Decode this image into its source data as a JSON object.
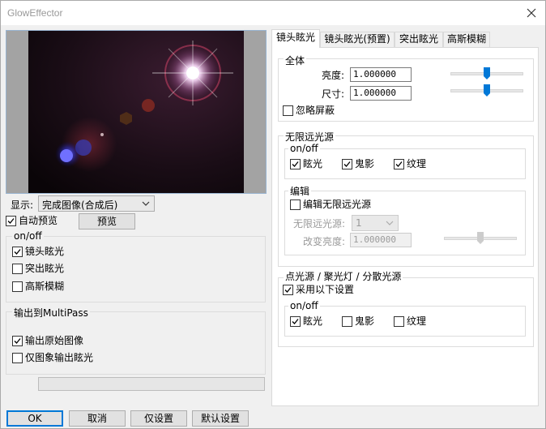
{
  "window": {
    "title": "GlowEffector"
  },
  "preview": {
    "display_label": "显示:",
    "display_value": "完成图像(合成后)",
    "auto_preview_label": "自动预览",
    "auto_preview_checked": true,
    "preview_button": "预览"
  },
  "onoff_left": {
    "title": "on/off",
    "items": [
      {
        "label": "镜头眩光",
        "checked": true
      },
      {
        "label": "突出眩光",
        "checked": false
      },
      {
        "label": "高斯模糊",
        "checked": false
      }
    ]
  },
  "output": {
    "title": "输出到MultiPass",
    "items": [
      {
        "label": "输出原始图像",
        "checked": true
      },
      {
        "label": "仅图象输出眩光",
        "checked": false
      }
    ]
  },
  "progress": {
    "value": 0
  },
  "buttons": {
    "ok": "OK",
    "cancel": "取消",
    "set_only": "仅设置",
    "default": "默认设置"
  },
  "tabs": [
    {
      "label": "镜头眩光",
      "active": true
    },
    {
      "label": "镜头眩光(预置)",
      "active": false
    },
    {
      "label": "突出眩光",
      "active": false
    },
    {
      "label": "高斯模糊",
      "active": false
    }
  ],
  "overall": {
    "title": "全体",
    "brightness_label": "亮度:",
    "brightness_value": "1.000000",
    "brightness_slider": 0.5,
    "size_label": "尺寸:",
    "size_value": "1.000000",
    "size_slider": 0.5,
    "ignore_mask_label": "忽略屏蔽",
    "ignore_mask_checked": false
  },
  "infinite": {
    "title": "无限远光源",
    "onoff_title": "on/off",
    "flare_label": "眩光",
    "flare_checked": true,
    "ghost_label": "鬼影",
    "ghost_checked": true,
    "texture_label": "纹理",
    "texture_checked": true,
    "edit_title": "编辑",
    "edit_label": "编辑无限远光源",
    "edit_checked": false,
    "source_label": "无限远光源:",
    "source_value": "1",
    "change_brightness_label": "改变亮度:",
    "change_brightness_value": "1.000000",
    "change_brightness_slider": 0.5
  },
  "point": {
    "title": "点光源 / 聚光灯 / 分散光源",
    "use_label": "采用以下设置",
    "use_checked": true,
    "onoff_title": "on/off",
    "flare_label": "眩光",
    "flare_checked": true,
    "ghost_label": "鬼影",
    "ghost_checked": false,
    "texture_label": "纹理",
    "texture_checked": false
  },
  "colors": {
    "accent": "#0078d7",
    "slider_thumb": "#0078d7",
    "group_border": "#dcdcdc"
  }
}
